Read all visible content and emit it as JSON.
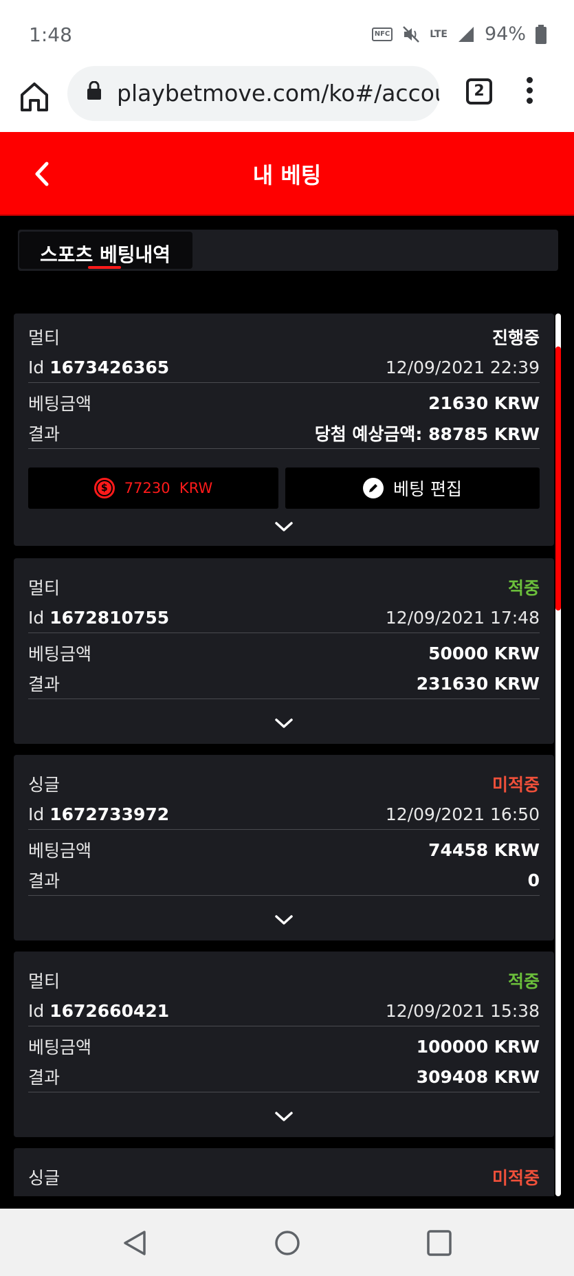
{
  "status_bar": {
    "time": "1:48",
    "battery": "94%",
    "network": "LTE",
    "nfc": "NFC"
  },
  "browser": {
    "url": "playbetmove.com/ko#/account",
    "tab_count": "2"
  },
  "header": {
    "title": "내 베팅"
  },
  "tabs": [
    {
      "label": "스포츠 베팅내역",
      "active": true
    }
  ],
  "labels": {
    "id_prefix": "Id",
    "stake": "베팅금액",
    "result": "결과"
  },
  "bets": [
    {
      "type": "멀티",
      "status": "진행중",
      "status_kind": "ongoing",
      "id": "1673426365",
      "datetime": "12/09/2021 22:39",
      "stake": "21630 KRW",
      "result": "당첨 예상금액: 88785 KRW",
      "cashout": "77230  KRW",
      "edit_label": "베팅 편집"
    },
    {
      "type": "멀티",
      "status": "적중",
      "status_kind": "won",
      "id": "1672810755",
      "datetime": "12/09/2021 17:48",
      "stake": "50000 KRW",
      "result": "231630 KRW"
    },
    {
      "type": "싱글",
      "status": "미적중",
      "status_kind": "lost",
      "id": "1672733972",
      "datetime": "12/09/2021 16:50",
      "stake": "74458 KRW",
      "result": "0"
    },
    {
      "type": "멀티",
      "status": "적중",
      "status_kind": "won",
      "id": "1672660421",
      "datetime": "12/09/2021 15:38",
      "stake": "100000 KRW",
      "result": "309408 KRW"
    },
    {
      "type": "싱글",
      "status": "미적중",
      "status_kind": "lost"
    }
  ],
  "colors": {
    "brand": "#fe0000",
    "won": "#6bbf3b",
    "lost": "#f0503a",
    "card": "#1c1d22"
  }
}
